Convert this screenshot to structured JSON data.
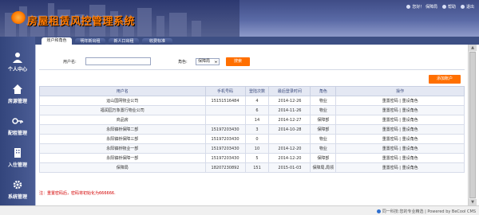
{
  "header": {
    "title": "房屋租赁风控管理系统",
    "links": [
      {
        "label": "您好！ 保障局",
        "icon": "user-icon"
      },
      {
        "label": "帮助",
        "icon": "help-icon"
      },
      {
        "label": "退出",
        "icon": "logout-icon"
      }
    ]
  },
  "tabs": [
    {
      "label": "账户和角色",
      "active": true
    },
    {
      "label": "明年新出租",
      "active": false
    },
    {
      "label": "新人口出租",
      "active": false
    },
    {
      "label": "收费标准",
      "active": false
    }
  ],
  "sidebar": [
    {
      "label": "个人中心",
      "icon": "person-icon"
    },
    {
      "label": "房源管理",
      "icon": "house-icon"
    },
    {
      "label": "配租管理",
      "icon": "key-icon"
    },
    {
      "label": "入住管理",
      "icon": "building-icon"
    },
    {
      "label": "系统管理",
      "icon": "gear-icon"
    },
    {
      "label": "",
      "icon": "more-icon"
    }
  ],
  "search": {
    "user_label": "用户名:",
    "user_value": "",
    "role_label": "角色:",
    "role_value": "保障局",
    "search_button": "搜索",
    "add_button": "添加账户"
  },
  "table": {
    "headers": [
      "用户名",
      "手机号码",
      "登陆次数",
      "最后登录时间",
      "角色",
      "操作"
    ],
    "rows": [
      {
        "name": "运山国网物业公司",
        "phone": "15151516484",
        "logins": "4",
        "last": "2014-12-26",
        "role": "物业",
        "ops": "重置密码 | 重设角色"
      },
      {
        "name": "福润园万象置行物业公司",
        "phone": "",
        "logins": "6",
        "last": "2014-11-26",
        "role": "物业",
        "ops": "重置密码 | 重设角色"
      },
      {
        "name": "商品房",
        "phone": "",
        "logins": "14",
        "last": "2014-12-27",
        "role": "保障部",
        "ops": "重置密码 | 重设角色"
      },
      {
        "name": "永阳镇桥保障二部",
        "phone": "15197203430",
        "logins": "3",
        "last": "2014-10-28",
        "role": "保障部",
        "ops": "重置密码 | 重设角色"
      },
      {
        "name": "永阳镇桥保障三部",
        "phone": "15197203430",
        "logins": "0",
        "last": "",
        "role": "物业",
        "ops": "重置密码 | 重设角色"
      },
      {
        "name": "永阳镇桥物业一部",
        "phone": "15197203430",
        "logins": "10",
        "last": "2014-12-20",
        "role": "物业",
        "ops": "重置密码 | 重设角色"
      },
      {
        "name": "永阳镇桥保障一部",
        "phone": "15197203430",
        "logins": "5",
        "last": "2014-12-20",
        "role": "保障部",
        "ops": "重置密码 | 重设角色"
      },
      {
        "name": "保障局",
        "phone": "18207230892",
        "logins": "151",
        "last": "2015-01-03",
        "role": "保障局,局领",
        "ops": "重置密码 | 重设角色"
      }
    ]
  },
  "note": "注：重置密码后，密码将初始化为666666.",
  "footer": {
    "text": "同一科技:您的专业精选 | Powered by BeCool CMS"
  },
  "colors": {
    "accent": "#ff6f00",
    "header": "#4b5c97",
    "note": "#d40000"
  }
}
